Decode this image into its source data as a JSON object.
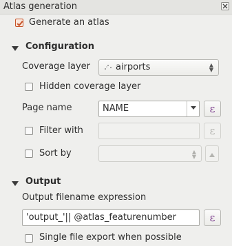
{
  "window": {
    "title": "Atlas generation",
    "close_icon": "close-icon"
  },
  "generate": {
    "label": "Generate an atlas",
    "checked": true
  },
  "configuration": {
    "title": "Configuration",
    "coverage_layer": {
      "label": "Coverage layer",
      "value": "airports",
      "icon": "point-layer-icon"
    },
    "hidden_coverage": {
      "label": "Hidden coverage layer",
      "checked": false
    },
    "page_name": {
      "label": "Page name",
      "value": "NAME"
    },
    "filter_with": {
      "label": "Filter with",
      "value": "",
      "checked": false
    },
    "sort_by": {
      "label": "Sort by",
      "value": "",
      "checked": false
    }
  },
  "output": {
    "title": "Output",
    "filename_label": "Output filename expression",
    "filename_value": "'output_'|| @atlas_featurenumber",
    "single_file": {
      "label": "Single file export when possible",
      "checked": false
    }
  },
  "expression_symbol": "ε",
  "colors": {
    "accent": "#c7552b",
    "expression": "#7a3a8c"
  }
}
